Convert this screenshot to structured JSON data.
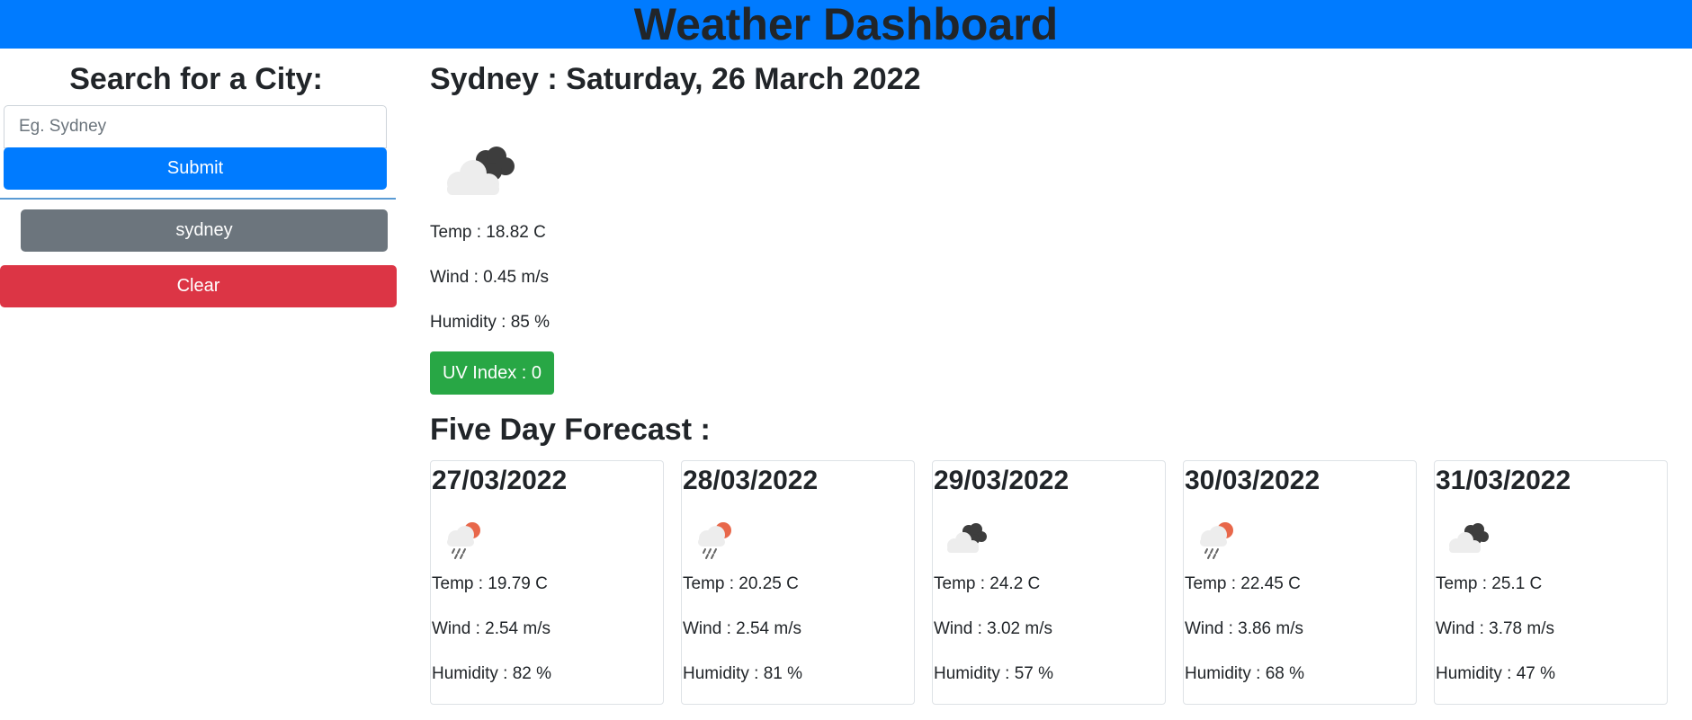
{
  "header": {
    "title": "Weather Dashboard"
  },
  "sidebar": {
    "search_title": "Search for a City:",
    "search_placeholder": "Eg. Sydney",
    "search_value": "",
    "submit_label": "Submit",
    "history": [
      "sydney"
    ],
    "clear_label": "Clear"
  },
  "current": {
    "heading": "Sydney : Saturday, 26 March 2022",
    "icon": "overcast-clouds-icon",
    "temp": "Temp : 18.82 C",
    "wind": "Wind : 0.45 m/s",
    "humidity": "Humidity : 85 %",
    "uv": "UV Index : 0",
    "uv_color": "#28a745"
  },
  "forecast": {
    "title": "Five Day Forecast :",
    "days": [
      {
        "date": "27/03/2022",
        "icon": "light-rain-icon",
        "temp": "Temp : 19.79 C",
        "wind": "Wind : 2.54 m/s",
        "humidity": "Humidity : 82 %"
      },
      {
        "date": "28/03/2022",
        "icon": "light-rain-icon",
        "temp": "Temp : 20.25 C",
        "wind": "Wind : 2.54 m/s",
        "humidity": "Humidity : 81 %"
      },
      {
        "date": "29/03/2022",
        "icon": "overcast-clouds-icon",
        "temp": "Temp : 24.2 C",
        "wind": "Wind : 3.02 m/s",
        "humidity": "Humidity : 57 %"
      },
      {
        "date": "30/03/2022",
        "icon": "light-rain-icon",
        "temp": "Temp : 22.45 C",
        "wind": "Wind : 3.86 m/s",
        "humidity": "Humidity : 68 %"
      },
      {
        "date": "31/03/2022",
        "icon": "overcast-clouds-icon",
        "temp": "Temp : 25.1 C",
        "wind": "Wind : 3.78 m/s",
        "humidity": "Humidity : 47 %"
      }
    ]
  },
  "colors": {
    "header_bg": "#007bff",
    "submit_bg": "#007bff",
    "history_bg": "#6c757d",
    "clear_bg": "#dc3545"
  }
}
